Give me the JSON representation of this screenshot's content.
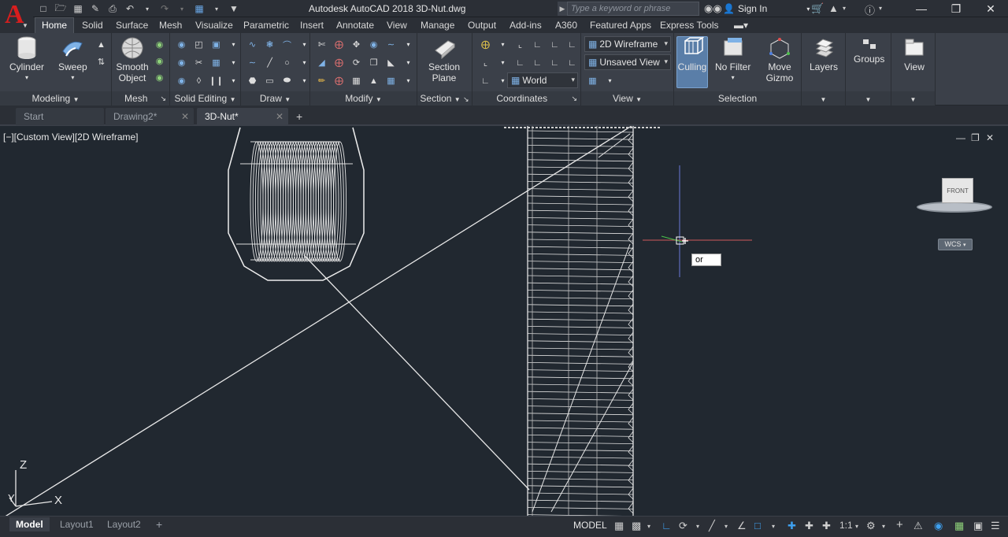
{
  "app": {
    "logo_letter": "A",
    "title": "Autodesk AutoCAD 2018    3D-Nut.dwg",
    "search_placeholder": "Type a keyword or phrase",
    "sign_in": "Sign In"
  },
  "quick_access": {
    "icons": [
      "new-icon",
      "open-icon",
      "save-icon",
      "save-as-icon",
      "plot-icon",
      "undo-icon",
      "redo-icon",
      "workspace-icon",
      "more-icon"
    ]
  },
  "ribbon_tabs": [
    "Home",
    "Solid",
    "Surface",
    "Mesh",
    "Visualize",
    "Parametric",
    "Insert",
    "Annotate",
    "View",
    "Manage",
    "Output",
    "Add-ins",
    "A360",
    "Featured Apps",
    "Express Tools"
  ],
  "ribbon": {
    "modeling": {
      "title": "Modeling",
      "cylinder": "Cylinder",
      "sweep": "Sweep"
    },
    "mesh": {
      "title": "Mesh",
      "smooth_object": "Smooth Object"
    },
    "solid_editing": {
      "title": "Solid Editing"
    },
    "draw": {
      "title": "Draw"
    },
    "modify": {
      "title": "Modify"
    },
    "section": {
      "title": "Section",
      "section_plane": "Section Plane"
    },
    "coordinates": {
      "title": "Coordinates",
      "world": "World"
    },
    "view": {
      "title": "View",
      "visual_style": "2D Wireframe",
      "named_view": "Unsaved View"
    },
    "selection": {
      "title": "Selection",
      "culling": "Culling",
      "no_filter": "No Filter",
      "move_gizmo": "Move Gizmo"
    },
    "layers": "Layers",
    "groups": "Groups",
    "view_panel": "View"
  },
  "file_tabs": [
    {
      "label": "Start",
      "active": false,
      "closable": false
    },
    {
      "label": "Drawing2*",
      "active": false,
      "closable": true
    },
    {
      "label": "3D-Nut*",
      "active": true,
      "closable": true
    }
  ],
  "viewport": {
    "label": "[−][Custom View][2D Wireframe]",
    "command_input": "or",
    "viewcube_face": "FRONT",
    "wcs": "WCS",
    "ucs_z": "Z",
    "ucs_y": "Y",
    "ucs_x": "X"
  },
  "status": {
    "layout_tabs": [
      "Model",
      "Layout1",
      "Layout2"
    ],
    "model_space": "MODEL",
    "scale": "1:1"
  },
  "colors": {
    "logo_red": "#d81e1e",
    "viewport_bg": "#212830",
    "ribbon_bg": "#3b4049",
    "active_toggle": "#3ea0ef"
  }
}
